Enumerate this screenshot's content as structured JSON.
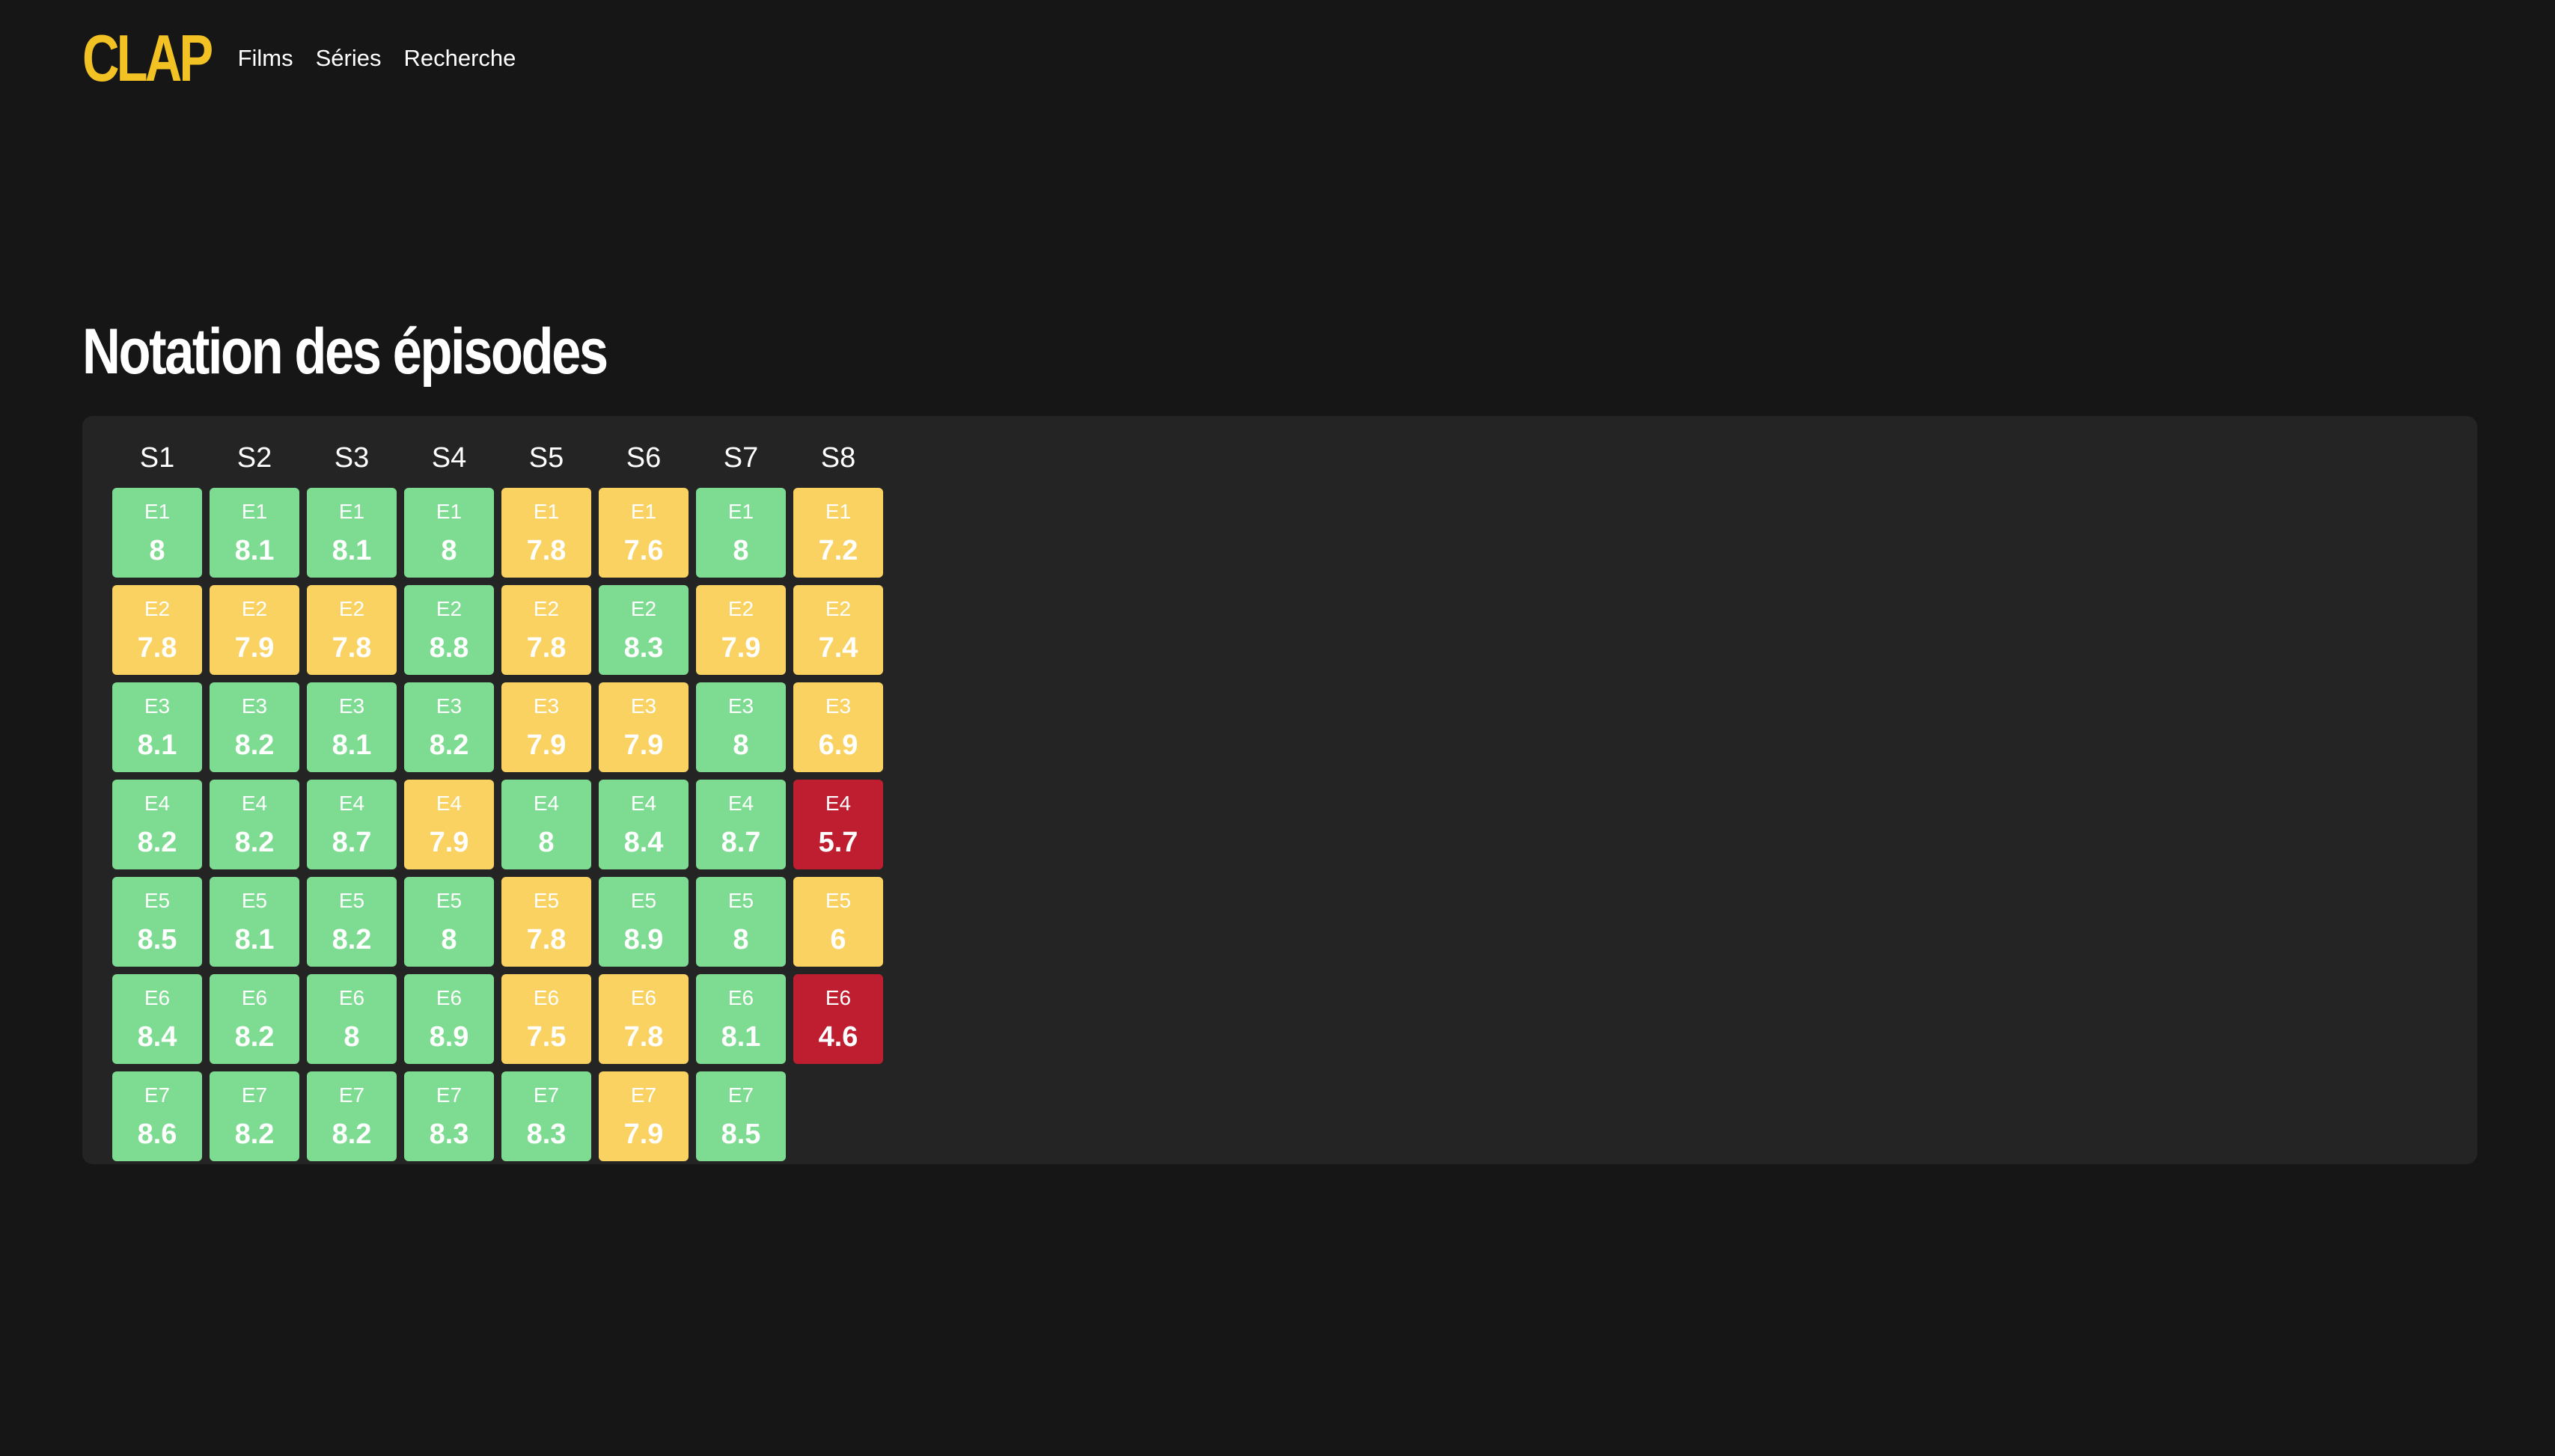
{
  "header": {
    "logo": "CLAP",
    "nav": [
      {
        "label": "Films"
      },
      {
        "label": "Séries"
      },
      {
        "label": "Recherche"
      }
    ]
  },
  "page_title": "Notation des épisodes",
  "colors": {
    "background": "#161616",
    "panel": "#242424",
    "logo": "#f2c224",
    "good": "#7ddc91",
    "mid": "#fad262",
    "bad": "#be1e30"
  },
  "seasons": [
    {
      "label": "S1",
      "episodes": [
        {
          "ep": "E1",
          "rating": "8",
          "level": "good"
        },
        {
          "ep": "E2",
          "rating": "7.8",
          "level": "mid"
        },
        {
          "ep": "E3",
          "rating": "8.1",
          "level": "good"
        },
        {
          "ep": "E4",
          "rating": "8.2",
          "level": "good"
        },
        {
          "ep": "E5",
          "rating": "8.5",
          "level": "good"
        },
        {
          "ep": "E6",
          "rating": "8.4",
          "level": "good"
        },
        {
          "ep": "E7",
          "rating": "8.6",
          "level": "good"
        }
      ]
    },
    {
      "label": "S2",
      "episodes": [
        {
          "ep": "E1",
          "rating": "8.1",
          "level": "good"
        },
        {
          "ep": "E2",
          "rating": "7.9",
          "level": "mid"
        },
        {
          "ep": "E3",
          "rating": "8.2",
          "level": "good"
        },
        {
          "ep": "E4",
          "rating": "8.2",
          "level": "good"
        },
        {
          "ep": "E5",
          "rating": "8.1",
          "level": "good"
        },
        {
          "ep": "E6",
          "rating": "8.2",
          "level": "good"
        },
        {
          "ep": "E7",
          "rating": "8.2",
          "level": "good"
        }
      ]
    },
    {
      "label": "S3",
      "episodes": [
        {
          "ep": "E1",
          "rating": "8.1",
          "level": "good"
        },
        {
          "ep": "E2",
          "rating": "7.8",
          "level": "mid"
        },
        {
          "ep": "E3",
          "rating": "8.1",
          "level": "good"
        },
        {
          "ep": "E4",
          "rating": "8.7",
          "level": "good"
        },
        {
          "ep": "E5",
          "rating": "8.2",
          "level": "good"
        },
        {
          "ep": "E6",
          "rating": "8",
          "level": "good"
        },
        {
          "ep": "E7",
          "rating": "8.2",
          "level": "good"
        }
      ]
    },
    {
      "label": "S4",
      "episodes": [
        {
          "ep": "E1",
          "rating": "8",
          "level": "good"
        },
        {
          "ep": "E2",
          "rating": "8.8",
          "level": "good"
        },
        {
          "ep": "E3",
          "rating": "8.2",
          "level": "good"
        },
        {
          "ep": "E4",
          "rating": "7.9",
          "level": "mid"
        },
        {
          "ep": "E5",
          "rating": "8",
          "level": "good"
        },
        {
          "ep": "E6",
          "rating": "8.9",
          "level": "good"
        },
        {
          "ep": "E7",
          "rating": "8.3",
          "level": "good"
        }
      ]
    },
    {
      "label": "S5",
      "episodes": [
        {
          "ep": "E1",
          "rating": "7.8",
          "level": "mid"
        },
        {
          "ep": "E2",
          "rating": "7.8",
          "level": "mid"
        },
        {
          "ep": "E3",
          "rating": "7.9",
          "level": "mid"
        },
        {
          "ep": "E4",
          "rating": "8",
          "level": "good"
        },
        {
          "ep": "E5",
          "rating": "7.8",
          "level": "mid"
        },
        {
          "ep": "E6",
          "rating": "7.5",
          "level": "mid"
        },
        {
          "ep": "E7",
          "rating": "8.3",
          "level": "good"
        }
      ]
    },
    {
      "label": "S6",
      "episodes": [
        {
          "ep": "E1",
          "rating": "7.6",
          "level": "mid"
        },
        {
          "ep": "E2",
          "rating": "8.3",
          "level": "good"
        },
        {
          "ep": "E3",
          "rating": "7.9",
          "level": "mid"
        },
        {
          "ep": "E4",
          "rating": "8.4",
          "level": "good"
        },
        {
          "ep": "E5",
          "rating": "8.9",
          "level": "good"
        },
        {
          "ep": "E6",
          "rating": "7.8",
          "level": "mid"
        },
        {
          "ep": "E7",
          "rating": "7.9",
          "level": "mid"
        }
      ]
    },
    {
      "label": "S7",
      "episodes": [
        {
          "ep": "E1",
          "rating": "8",
          "level": "good"
        },
        {
          "ep": "E2",
          "rating": "7.9",
          "level": "mid"
        },
        {
          "ep": "E3",
          "rating": "8",
          "level": "good"
        },
        {
          "ep": "E4",
          "rating": "8.7",
          "level": "good"
        },
        {
          "ep": "E5",
          "rating": "8",
          "level": "good"
        },
        {
          "ep": "E6",
          "rating": "8.1",
          "level": "good"
        },
        {
          "ep": "E7",
          "rating": "8.5",
          "level": "good"
        }
      ]
    },
    {
      "label": "S8",
      "episodes": [
        {
          "ep": "E1",
          "rating": "7.2",
          "level": "mid"
        },
        {
          "ep": "E2",
          "rating": "7.4",
          "level": "mid"
        },
        {
          "ep": "E3",
          "rating": "6.9",
          "level": "mid"
        },
        {
          "ep": "E4",
          "rating": "5.7",
          "level": "bad"
        },
        {
          "ep": "E5",
          "rating": "6",
          "level": "mid"
        },
        {
          "ep": "E6",
          "rating": "4.6",
          "level": "bad"
        }
      ]
    }
  ]
}
